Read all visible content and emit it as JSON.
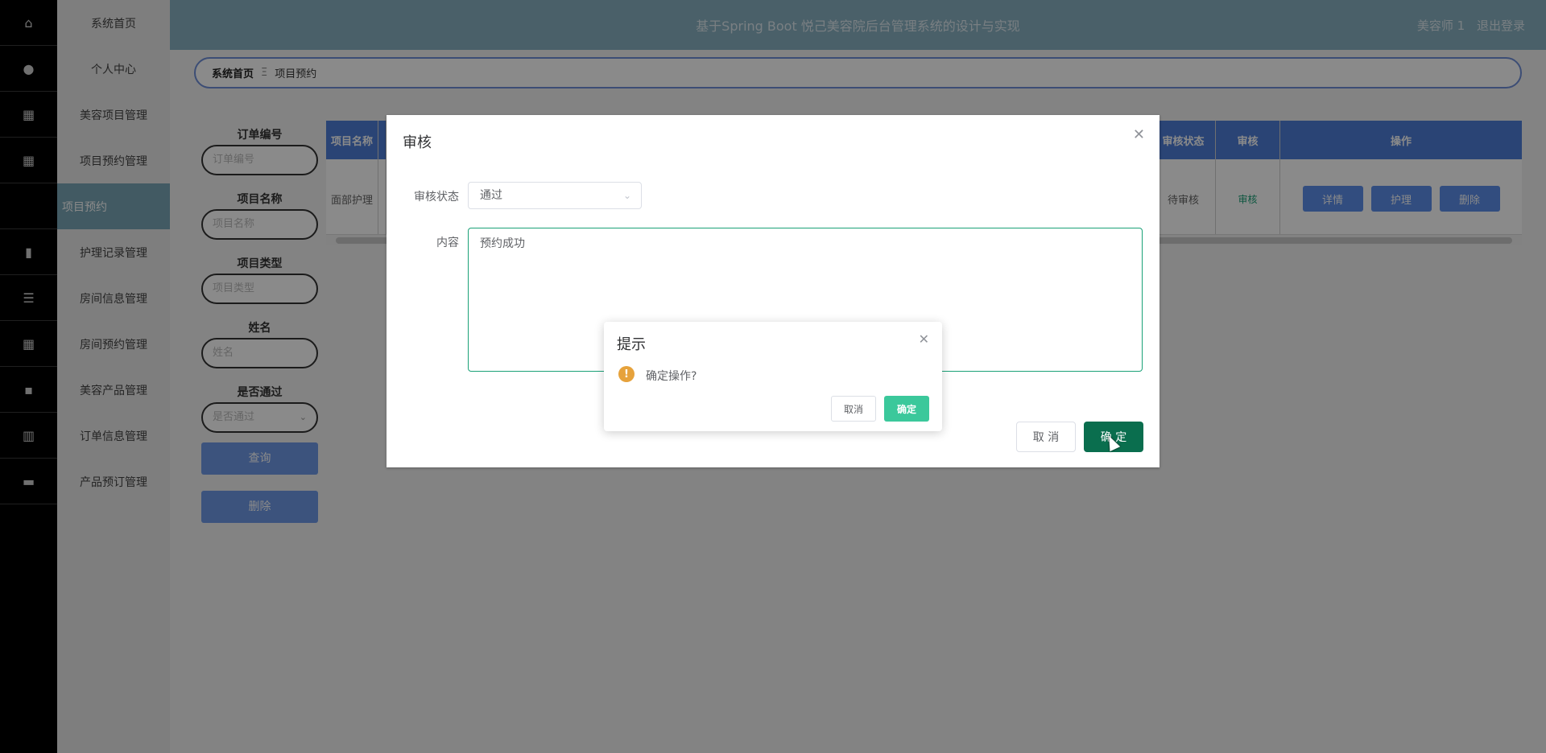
{
  "app": {
    "title": "基于Spring Boot 悦己美容院后台管理系统的设计与实现",
    "user": "美容师 1",
    "logout": "退出登录"
  },
  "sidebar": {
    "items": [
      {
        "label": "系统首页",
        "icon": "home-icon"
      },
      {
        "label": "个人中心",
        "icon": "user-icon"
      },
      {
        "label": "美容项目管理",
        "icon": "grid-icon"
      },
      {
        "label": "项目预约管理",
        "icon": "grid-icon"
      },
      {
        "label": "项目预约",
        "icon": "",
        "active": true
      },
      {
        "label": "护理记录管理",
        "icon": "book-icon"
      },
      {
        "label": "房间信息管理",
        "icon": "list-icon"
      },
      {
        "label": "房间预约管理",
        "icon": "grid-icon"
      },
      {
        "label": "美容产品管理",
        "icon": "chat-icon"
      },
      {
        "label": "订单信息管理",
        "icon": "chart-icon"
      },
      {
        "label": "产品预订管理",
        "icon": "box-icon"
      }
    ]
  },
  "breadcrumb": {
    "home": "系统首页",
    "sep": "Ξ",
    "current": "项目预约"
  },
  "search": {
    "order_no_label": "订单编号",
    "order_no_placeholder": "订单编号",
    "project_name_label": "项目名称",
    "project_name_placeholder": "项目名称",
    "project_type_label": "项目类型",
    "project_type_placeholder": "项目类型",
    "name_label": "姓名",
    "name_placeholder": "姓名",
    "passed_label": "是否通过",
    "passed_placeholder": "是否通过",
    "query_button": "查询",
    "delete_button": "删除"
  },
  "table": {
    "headers": {
      "project_name": "项目名称",
      "audit_status": "审核状态",
      "audit": "审核",
      "actions": "操作"
    },
    "row": {
      "project_name": "面部护理",
      "audit_status": "待审核",
      "audit_link": "审核",
      "detail": "详情",
      "care": "护理",
      "delete": "删除"
    }
  },
  "dialog": {
    "title": "审核",
    "status_label": "审核状态",
    "status_value": "通过",
    "content_label": "内容",
    "content_value": "预约成功",
    "cancel": "取 消",
    "confirm": "确 定"
  },
  "msgbox": {
    "title": "提示",
    "message": "确定操作?",
    "cancel": "取消",
    "confirm": "确定"
  }
}
